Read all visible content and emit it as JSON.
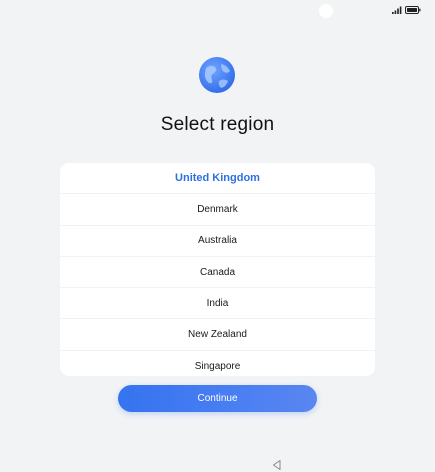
{
  "title": "Select region",
  "regions": [
    {
      "label": "United Kingdom",
      "selected": true
    },
    {
      "label": "Denmark",
      "selected": false
    },
    {
      "label": "Australia",
      "selected": false
    },
    {
      "label": "Canada",
      "selected": false
    },
    {
      "label": "India",
      "selected": false
    },
    {
      "label": "New Zealand",
      "selected": false
    },
    {
      "label": "Singapore",
      "selected": false
    }
  ],
  "continue_label": "Continue",
  "icons": {
    "globe": "globe-icon",
    "signal": "signal-icon",
    "battery": "battery-icon",
    "back_nav": "back-nav-icon"
  },
  "colors": {
    "accent": "#2f6fe4",
    "background": "#f1f3f5",
    "button_gradient_start": "#3573f0",
    "button_gradient_end": "#5a86f0"
  }
}
